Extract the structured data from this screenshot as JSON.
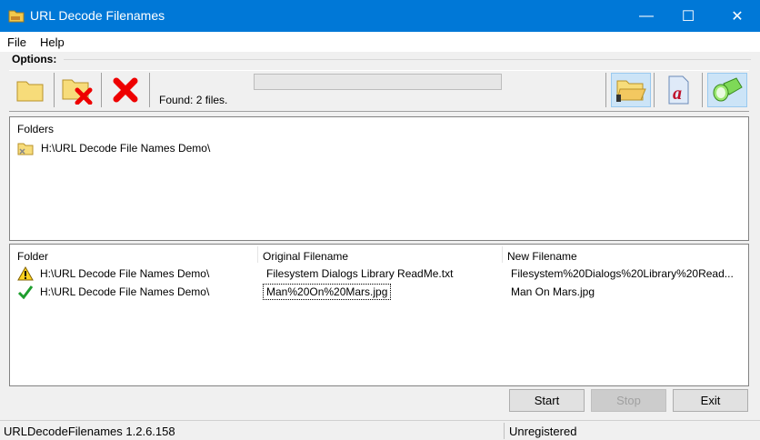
{
  "window": {
    "title": "URL Decode Filenames",
    "minimize": "—",
    "maximize": "☐",
    "close": "✕"
  },
  "menu": {
    "file": "File",
    "help": "Help"
  },
  "options_label": "Options:",
  "toolbar": {
    "found": "Found: 2 files.",
    "progress_percent": 0,
    "icons": [
      "add-folder-icon",
      "remove-folder-icon",
      "clear-icon",
      "open-folder-icon",
      "font-icon",
      "flashlight-icon"
    ]
  },
  "folders": {
    "header": "Folders",
    "items": [
      "H:\\URL Decode File Names Demo\\"
    ]
  },
  "files": {
    "columns": [
      "Folder",
      "Original Filename",
      "New Filename"
    ],
    "rows": [
      {
        "status": "warning",
        "folder": "H:\\URL Decode File Names Demo\\",
        "original": "Filesystem Dialogs Library ReadMe.txt",
        "new": "Filesystem%20Dialogs%20Library%20Read..."
      },
      {
        "status": "ok",
        "folder": "H:\\URL Decode File Names Demo\\",
        "original": "Man%20On%20Mars.jpg",
        "new": "Man On Mars.jpg"
      }
    ]
  },
  "buttons": {
    "start": "Start",
    "stop": "Stop",
    "exit": "Exit"
  },
  "status": {
    "version": "URLDecodeFilenames 1.2.6.158",
    "registration": "Unregistered"
  },
  "colors": {
    "titlebar": "#0078d7",
    "toolbar_active": "#cce4f7"
  }
}
